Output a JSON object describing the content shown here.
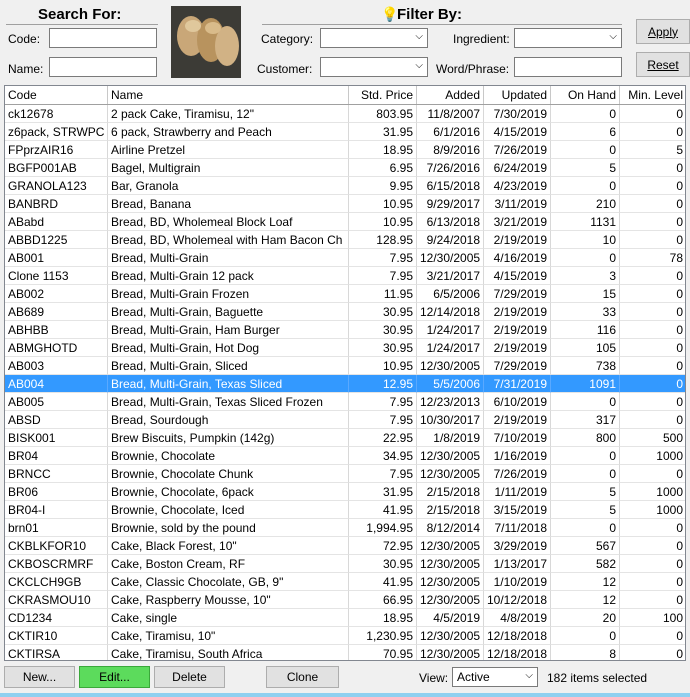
{
  "search": {
    "title": "Search For:",
    "code_label": "Code:",
    "name_label": "Name:",
    "code_value": "",
    "name_value": ""
  },
  "filter": {
    "title": "Filter By:",
    "category_label": "Category:",
    "ingredient_label": "Ingredient:",
    "customer_label": "Customer:",
    "word_label": "Word/Phrase:",
    "category_value": "",
    "ingredient_value": "",
    "customer_value": "",
    "word_value": ""
  },
  "buttons": {
    "apply": "Apply",
    "reset": "Reset",
    "new": "New...",
    "edit": "Edit...",
    "delete": "Delete",
    "clone": "Clone"
  },
  "footer": {
    "view_label": "View:",
    "view_value": "Active",
    "count_text": "182 items selected"
  },
  "colors": {
    "selected_row": "#3399ff",
    "edit_button": "#5cdb5c",
    "bottom_strip": "#8fd0f0"
  },
  "icons": {
    "filter": "lightbulb-icon",
    "dropdown": "chevron-down-icon"
  },
  "table": {
    "headers": [
      "Code",
      "Name",
      "Std. Price",
      "Added",
      "Updated",
      "On Hand",
      "Min. Level"
    ],
    "selected_index": 15,
    "rows": [
      [
        "ck12678",
        "2 pack Cake, Tiramisu, 12\"",
        "803.95",
        "11/8/2007",
        "7/30/2019",
        "0",
        "0"
      ],
      [
        "z6pack, STRWPC",
        "6 pack, Strawberry and Peach",
        "31.95",
        "6/1/2016",
        "4/15/2019",
        "6",
        "0"
      ],
      [
        "FPprzAIR16",
        "Airline Pretzel",
        "18.95",
        "8/9/2016",
        "7/26/2019",
        "0",
        "5"
      ],
      [
        "BGFP001AB",
        "Bagel, Multigrain",
        "6.95",
        "7/26/2016",
        "6/24/2019",
        "5",
        "0"
      ],
      [
        "GRANOLA123",
        "Bar, Granola",
        "9.95",
        "6/15/2018",
        "4/23/2019",
        "0",
        "0"
      ],
      [
        "BANBRD",
        "Bread, Banana",
        "10.95",
        "9/29/2017",
        "3/11/2019",
        "210",
        "0"
      ],
      [
        "ABabd",
        "Bread, BD, Wholemeal Block Loaf",
        "10.95",
        "6/13/2018",
        "3/21/2019",
        "1131",
        "0"
      ],
      [
        "ABBD1225",
        "Bread, BD, Wholemeal with Ham Bacon Ch",
        "128.95",
        "9/24/2018",
        "2/19/2019",
        "10",
        "0"
      ],
      [
        "AB001",
        "Bread, Multi-Grain",
        "7.95",
        "12/30/2005",
        "4/16/2019",
        "0",
        "78"
      ],
      [
        "Clone 1153",
        "Bread, Multi-Grain 12 pack",
        "7.95",
        "3/21/2017",
        "4/15/2019",
        "3",
        "0"
      ],
      [
        "AB002",
        "Bread, Multi-Grain Frozen",
        "11.95",
        "6/5/2006",
        "7/29/2019",
        "15",
        "0"
      ],
      [
        "AB689",
        "Bread, Multi-Grain, Baguette",
        "30.95",
        "12/14/2018",
        "2/19/2019",
        "33",
        "0"
      ],
      [
        "ABHBB",
        "Bread, Multi-Grain, Ham Burger",
        "30.95",
        "1/24/2017",
        "2/19/2019",
        "116",
        "0"
      ],
      [
        "ABMGHOTD",
        "Bread, Multi-Grain, Hot Dog",
        "30.95",
        "1/24/2017",
        "2/19/2019",
        "105",
        "0"
      ],
      [
        "AB003",
        "Bread, Multi-Grain, Sliced",
        "10.95",
        "12/30/2005",
        "7/29/2019",
        "738",
        "0"
      ],
      [
        "AB004",
        "Bread, Multi-Grain, Texas Sliced",
        "12.95",
        "5/5/2006",
        "7/31/2019",
        "1091",
        "0"
      ],
      [
        "AB005",
        "Bread, Multi-Grain, Texas Sliced Frozen",
        "7.95",
        "12/23/2013",
        "6/10/2019",
        "0",
        "0"
      ],
      [
        "ABSD",
        "Bread, Sourdough",
        "7.95",
        "10/30/2017",
        "2/19/2019",
        "317",
        "0"
      ],
      [
        "BISK001",
        "Brew Biscuits, Pumpkin (142g)",
        "22.95",
        "1/8/2019",
        "7/10/2019",
        "800",
        "500"
      ],
      [
        "BR04",
        "Brownie, Chocolate",
        "34.95",
        "12/30/2005",
        "1/16/2019",
        "0",
        "1000"
      ],
      [
        "BRNCC",
        "Brownie, Chocolate Chunk",
        "7.95",
        "12/30/2005",
        "7/26/2019",
        "0",
        "0"
      ],
      [
        "BR06",
        "Brownie, Chocolate, 6pack",
        "31.95",
        "2/15/2018",
        "1/11/2019",
        "5",
        "1000"
      ],
      [
        "BR04-I",
        "Brownie, Chocolate, Iced",
        "41.95",
        "2/15/2018",
        "3/15/2019",
        "5",
        "1000"
      ],
      [
        "brn01",
        "Brownie, sold by the pound",
        "1,994.95",
        "8/12/2014",
        "7/11/2018",
        "0",
        "0"
      ],
      [
        "CKBLKFOR10",
        "Cake, Black Forest, 10\"",
        "72.95",
        "12/30/2005",
        "3/29/2019",
        "567",
        "0"
      ],
      [
        "CKBOSCRMRF",
        "Cake, Boston Cream, RF",
        "30.95",
        "12/30/2005",
        "1/13/2017",
        "582",
        "0"
      ],
      [
        "CKCLCH9GB",
        "Cake, Classic Chocolate, GB, 9\"",
        "41.95",
        "12/30/2005",
        "1/10/2019",
        "12",
        "0"
      ],
      [
        "CKRASMOU10",
        "Cake, Raspberry Mousse, 10\"",
        "66.95",
        "12/30/2005",
        "10/12/2018",
        "12",
        "0"
      ],
      [
        "CD1234",
        "Cake, single",
        "18.95",
        "4/5/2019",
        "4/8/2019",
        "20",
        "100"
      ],
      [
        "CKTIR10",
        "Cake, Tiramisu, 10\"",
        "1,230.95",
        "12/30/2005",
        "12/18/2018",
        "0",
        "0"
      ],
      [
        "CKTIRSA",
        "Cake, Tiramisu, South Africa",
        "70.95",
        "12/30/2005",
        "12/18/2018",
        "8",
        "0"
      ]
    ]
  }
}
